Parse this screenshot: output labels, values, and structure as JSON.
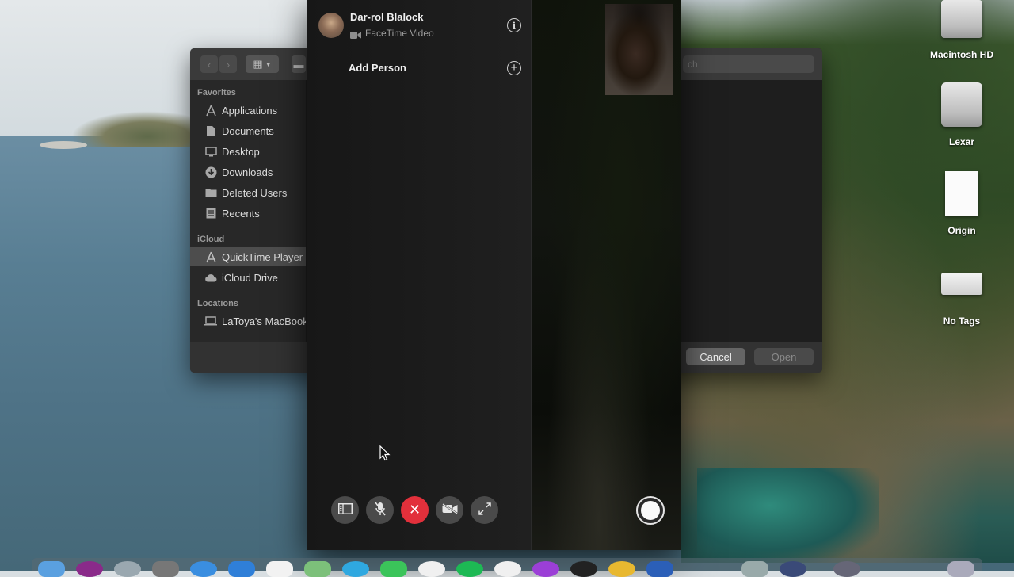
{
  "finder": {
    "sidebar": {
      "favorites_header": "Favorites",
      "icloud_header": "iCloud",
      "locations_header": "Locations",
      "favorites": [
        {
          "label": "Applications",
          "icon": "applications-icon"
        },
        {
          "label": "Documents",
          "icon": "documents-icon"
        },
        {
          "label": "Desktop",
          "icon": "desktop-icon"
        },
        {
          "label": "Downloads",
          "icon": "downloads-icon"
        },
        {
          "label": "Deleted Users",
          "icon": "folder-icon"
        },
        {
          "label": "Recents",
          "icon": "recents-icon"
        }
      ],
      "icloud": [
        {
          "label": "QuickTime Player",
          "icon": "applications-icon",
          "selected": true
        },
        {
          "label": "iCloud Drive",
          "icon": "cloud-icon"
        }
      ],
      "locations": [
        {
          "label": "LaToya's MacBook",
          "icon": "laptop-icon"
        }
      ]
    },
    "search_placeholder": "ch",
    "cancel_label": "Cancel",
    "open_label": "Open"
  },
  "facetime": {
    "contact_name": "Dar-rol Blalock",
    "call_type": "FaceTime Video",
    "add_person_label": "Add Person",
    "controls": [
      {
        "name": "sidebar-toggle-icon"
      },
      {
        "name": "mute-microphone-icon"
      },
      {
        "name": "end-call-icon"
      },
      {
        "name": "camera-off-icon"
      },
      {
        "name": "fullscreen-icon"
      }
    ],
    "end_call_color": "#e2303b"
  },
  "desktop_icons": [
    {
      "label": "Macintosh HD",
      "icon": "hard-drive-icon"
    },
    {
      "label": "Lexar",
      "icon": "external-drive-icon"
    },
    {
      "label": "Origin",
      "icon": "document-icon"
    },
    {
      "label": "No Tags",
      "icon": "image-file-icon"
    }
  ]
}
